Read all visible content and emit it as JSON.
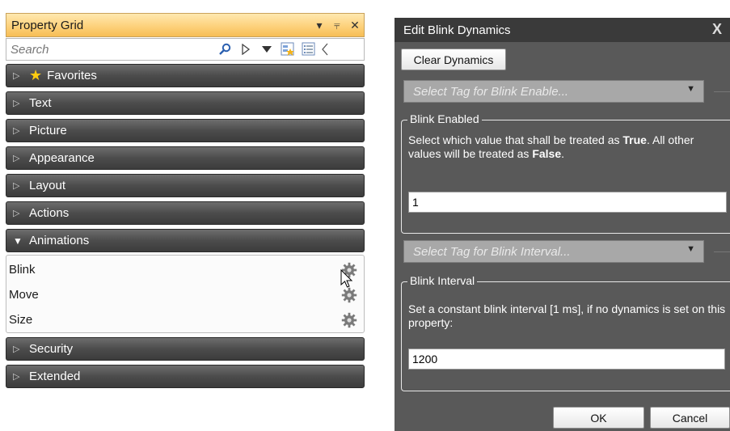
{
  "property_grid": {
    "title": "Property Grid",
    "controls": [
      "▾",
      "⫧",
      "✕"
    ],
    "search_placeholder": "Search",
    "categories": [
      {
        "label": "Favorites",
        "expanded": false,
        "star": true
      },
      {
        "label": "Text",
        "expanded": false
      },
      {
        "label": "Picture",
        "expanded": false
      },
      {
        "label": "Appearance",
        "expanded": false
      },
      {
        "label": "Layout",
        "expanded": false
      },
      {
        "label": "Actions",
        "expanded": false
      },
      {
        "label": "Animations",
        "expanded": true
      },
      {
        "label": "Security",
        "expanded": false
      },
      {
        "label": "Extended",
        "expanded": false
      }
    ],
    "animations": [
      "Blink",
      "Move",
      "Size"
    ]
  },
  "dialog": {
    "title": "Edit Blink Dynamics",
    "close": "X",
    "clear_button": "Clear Dynamics",
    "enable_tag_placeholder": "Select Tag for Blink Enable...",
    "blink_enabled": {
      "title": "Blink Enabled",
      "desc_1": "Select which value that shall be treated as ",
      "desc_true": "True",
      "desc_2": ". All other values will be treated as ",
      "desc_false": "False",
      "desc_3": ".",
      "value": "1"
    },
    "interval_tag_placeholder": "Select Tag for Blink Interval...",
    "blink_interval": {
      "title": "Blink Interval",
      "desc": "Set a constant blink interval [1 ms], if no dynamics is set on this property:",
      "value": "1200"
    },
    "ok": "OK",
    "cancel": "Cancel"
  },
  "colors": {
    "title_orange": "#fdd27c",
    "category_dark": "#4c4c4c",
    "dialog_bg": "#595959"
  }
}
